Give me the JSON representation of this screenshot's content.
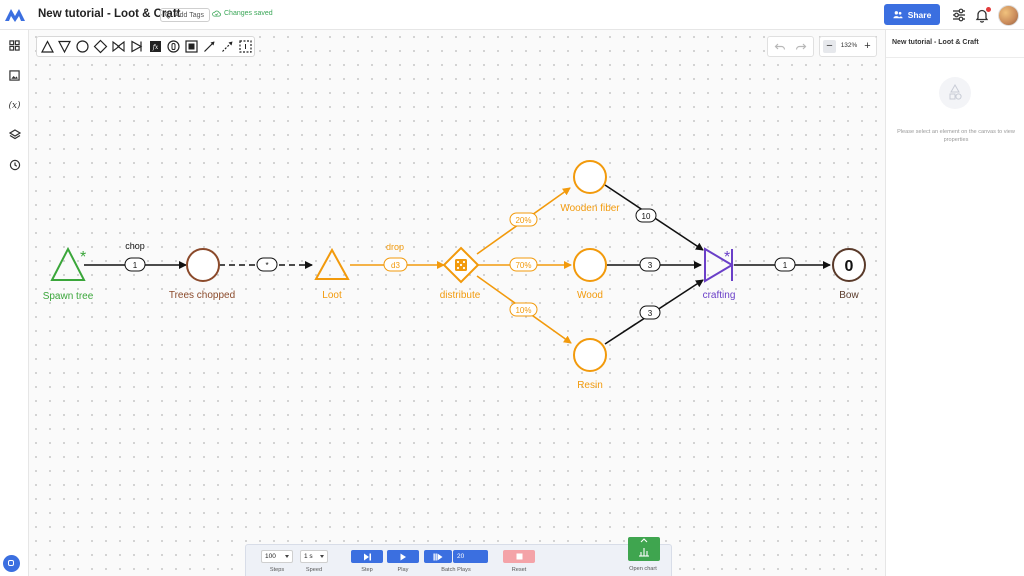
{
  "header": {
    "title": "New tutorial - Loot & Craft",
    "add_tags_label": "Add Tags",
    "save_status": "Changes saved",
    "share_label": "Share"
  },
  "sidebar": {
    "items": [
      {
        "name": "components",
        "icon": "grid-icon"
      },
      {
        "name": "image",
        "icon": "image-icon"
      },
      {
        "name": "variables",
        "icon": "variables-icon",
        "label": "(x)"
      },
      {
        "name": "layers",
        "icon": "layers-icon"
      },
      {
        "name": "history",
        "icon": "history-icon"
      }
    ]
  },
  "toolbar": {
    "tools": [
      "source-triangle-icon",
      "drain-triangle-icon",
      "pool-circle-icon",
      "gate-diamond-icon",
      "converter-icon",
      "trader-icon",
      "register-icon",
      "delay-icon",
      "end-condition-icon",
      "resource-connection-icon",
      "state-connection-icon",
      "selection-icon"
    ]
  },
  "zoom": {
    "value": "132%"
  },
  "right_panel": {
    "title": "New tutorial - Loot & Craft",
    "hint": "Please select an element on the canvas to view properties"
  },
  "diagram": {
    "nodes": {
      "spawn_tree": {
        "label": "Spawn tree",
        "color": "#3aa63a",
        "marker": "*"
      },
      "trees_chopped": {
        "label": "Trees chopped",
        "color": "#8b4a2b"
      },
      "loot": {
        "label": "Loot",
        "color": "#f29a0c"
      },
      "distribute": {
        "label": "distribute",
        "color": "#f29a0c"
      },
      "wooden_fiber": {
        "label": "Wooden fiber",
        "color": "#f29a0c"
      },
      "wood": {
        "label": "Wood",
        "color": "#f29a0c"
      },
      "resin": {
        "label": "Resin",
        "color": "#f29a0c"
      },
      "crafting": {
        "label": "crafting",
        "color": "#6a3fc8",
        "marker": "*"
      },
      "bow": {
        "label": "Bow",
        "value": "0",
        "color": "#5a3a2a"
      }
    },
    "edges": {
      "chop": {
        "name": "chop",
        "value": "1"
      },
      "trees_to_loot": {
        "value": "*"
      },
      "drop": {
        "name": "drop",
        "value": "d3"
      },
      "to_fiber": {
        "value": "20%"
      },
      "to_wood": {
        "value": "70%"
      },
      "to_resin": {
        "value": "10%"
      },
      "fiber_to_craft": {
        "value": "10"
      },
      "wood_to_craft": {
        "value": "3"
      },
      "resin_to_craft": {
        "value": "3"
      },
      "craft_to_bow": {
        "value": "1"
      }
    }
  },
  "controls": {
    "steps": {
      "value": "100",
      "label": "Steps"
    },
    "speed": {
      "value": "1 s",
      "label": "Speed"
    },
    "step_label": "Step",
    "play_label": "Play",
    "batch": {
      "value": "20",
      "label": "Batch Plays"
    },
    "reset_label": "Reset",
    "open_chart_label": "Open chart"
  },
  "colors": {
    "accent": "#3b6fe0",
    "source": "#3aa63a",
    "pool": "#8b4a2b",
    "orange": "#f29a0c",
    "converter": "#6a3fc8",
    "reset": "#f4a3a8",
    "chart": "#3fa54f"
  }
}
